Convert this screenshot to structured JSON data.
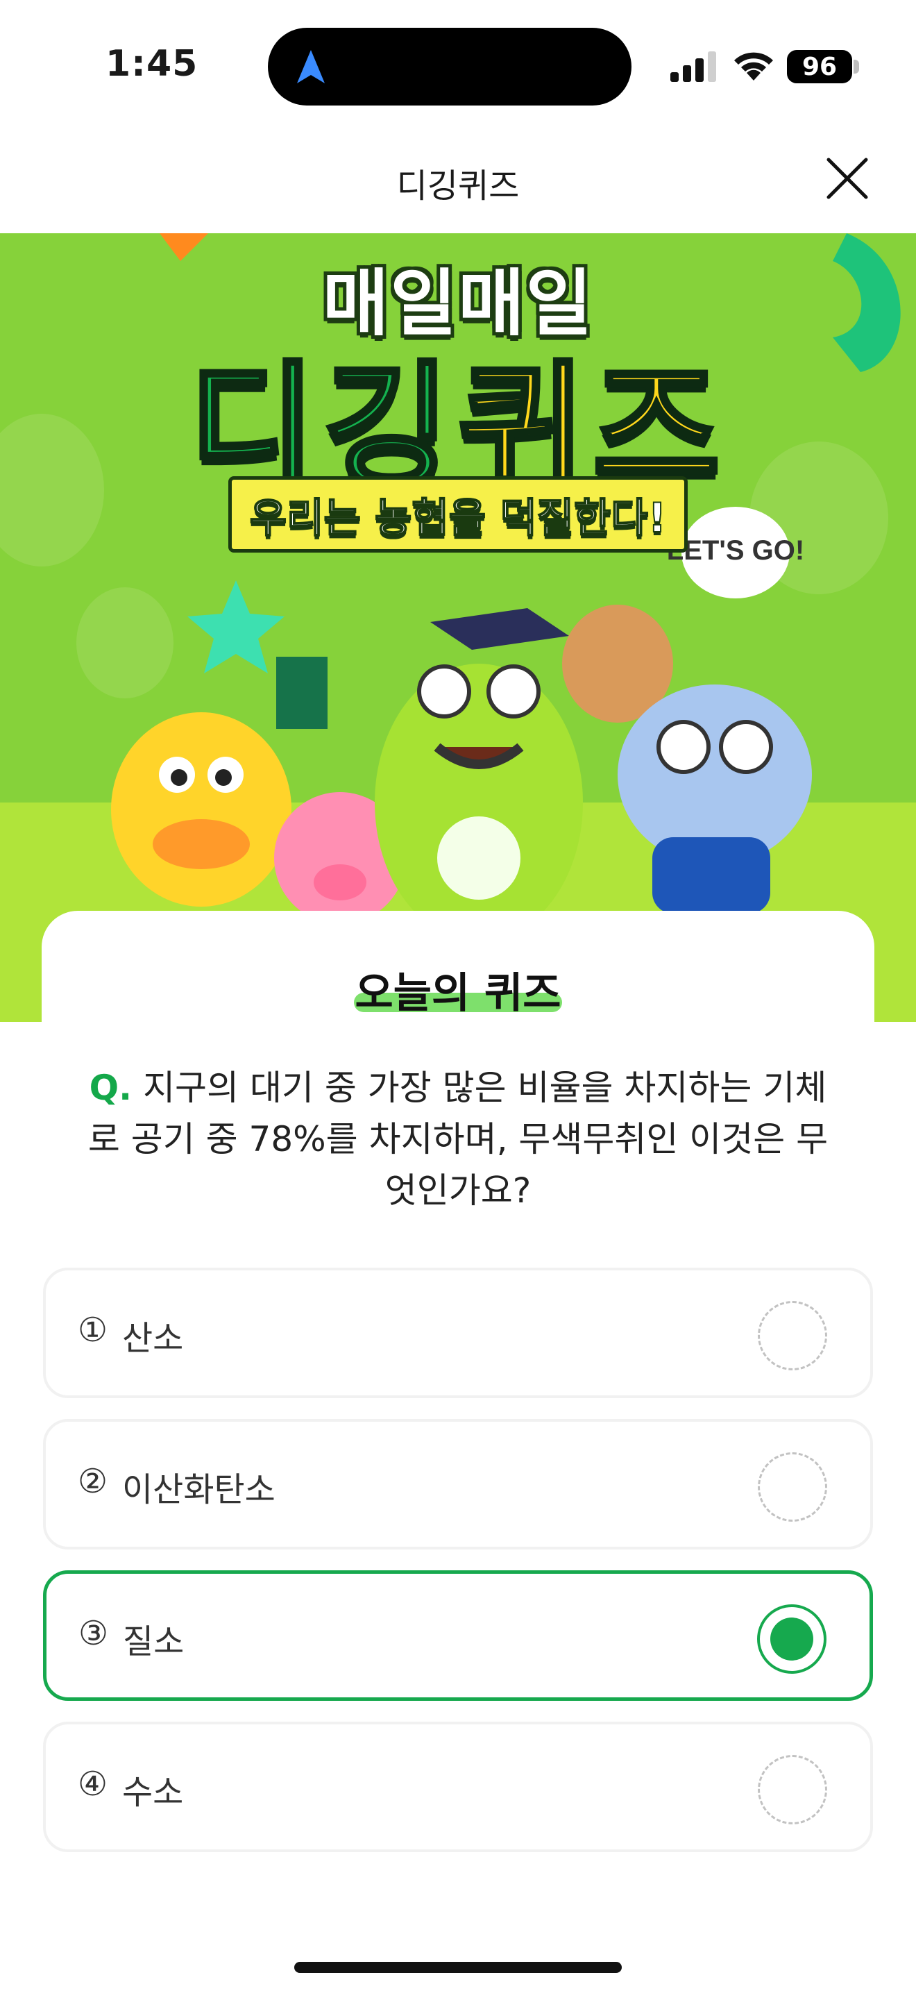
{
  "status_bar": {
    "time": "1:45",
    "battery": "96",
    "icons": [
      "navigation-arrow-icon",
      "cell-signal-icon",
      "wifi-icon",
      "battery-icon"
    ]
  },
  "header": {
    "title": "디깅퀴즈",
    "close_icon": "close-icon"
  },
  "banner": {
    "top_text": "매일매일",
    "main_green": "디깅",
    "main_yellow": "퀴즈",
    "slogan": "우리는 농협을 덕질한다!",
    "speech_bubble": "LET'S GO!"
  },
  "quiz": {
    "heading": "오늘의 퀴즈",
    "q_prefix": "Q.",
    "question": "지구의 대기 중 가장 많은 비율을 차지하는 기체로 공기 중 78%를 차지하며, 무색무취인 이것은 무엇인가요?",
    "options": [
      {
        "num": "①",
        "label": "산소",
        "selected": false
      },
      {
        "num": "②",
        "label": "이산화탄소",
        "selected": false
      },
      {
        "num": "③",
        "label": "질소",
        "selected": true
      },
      {
        "num": "④",
        "label": "수소",
        "selected": false
      }
    ]
  },
  "colors": {
    "accent": "#16a94e",
    "banner_bg": "#8ed63a",
    "highlight": "#7ee06c"
  }
}
